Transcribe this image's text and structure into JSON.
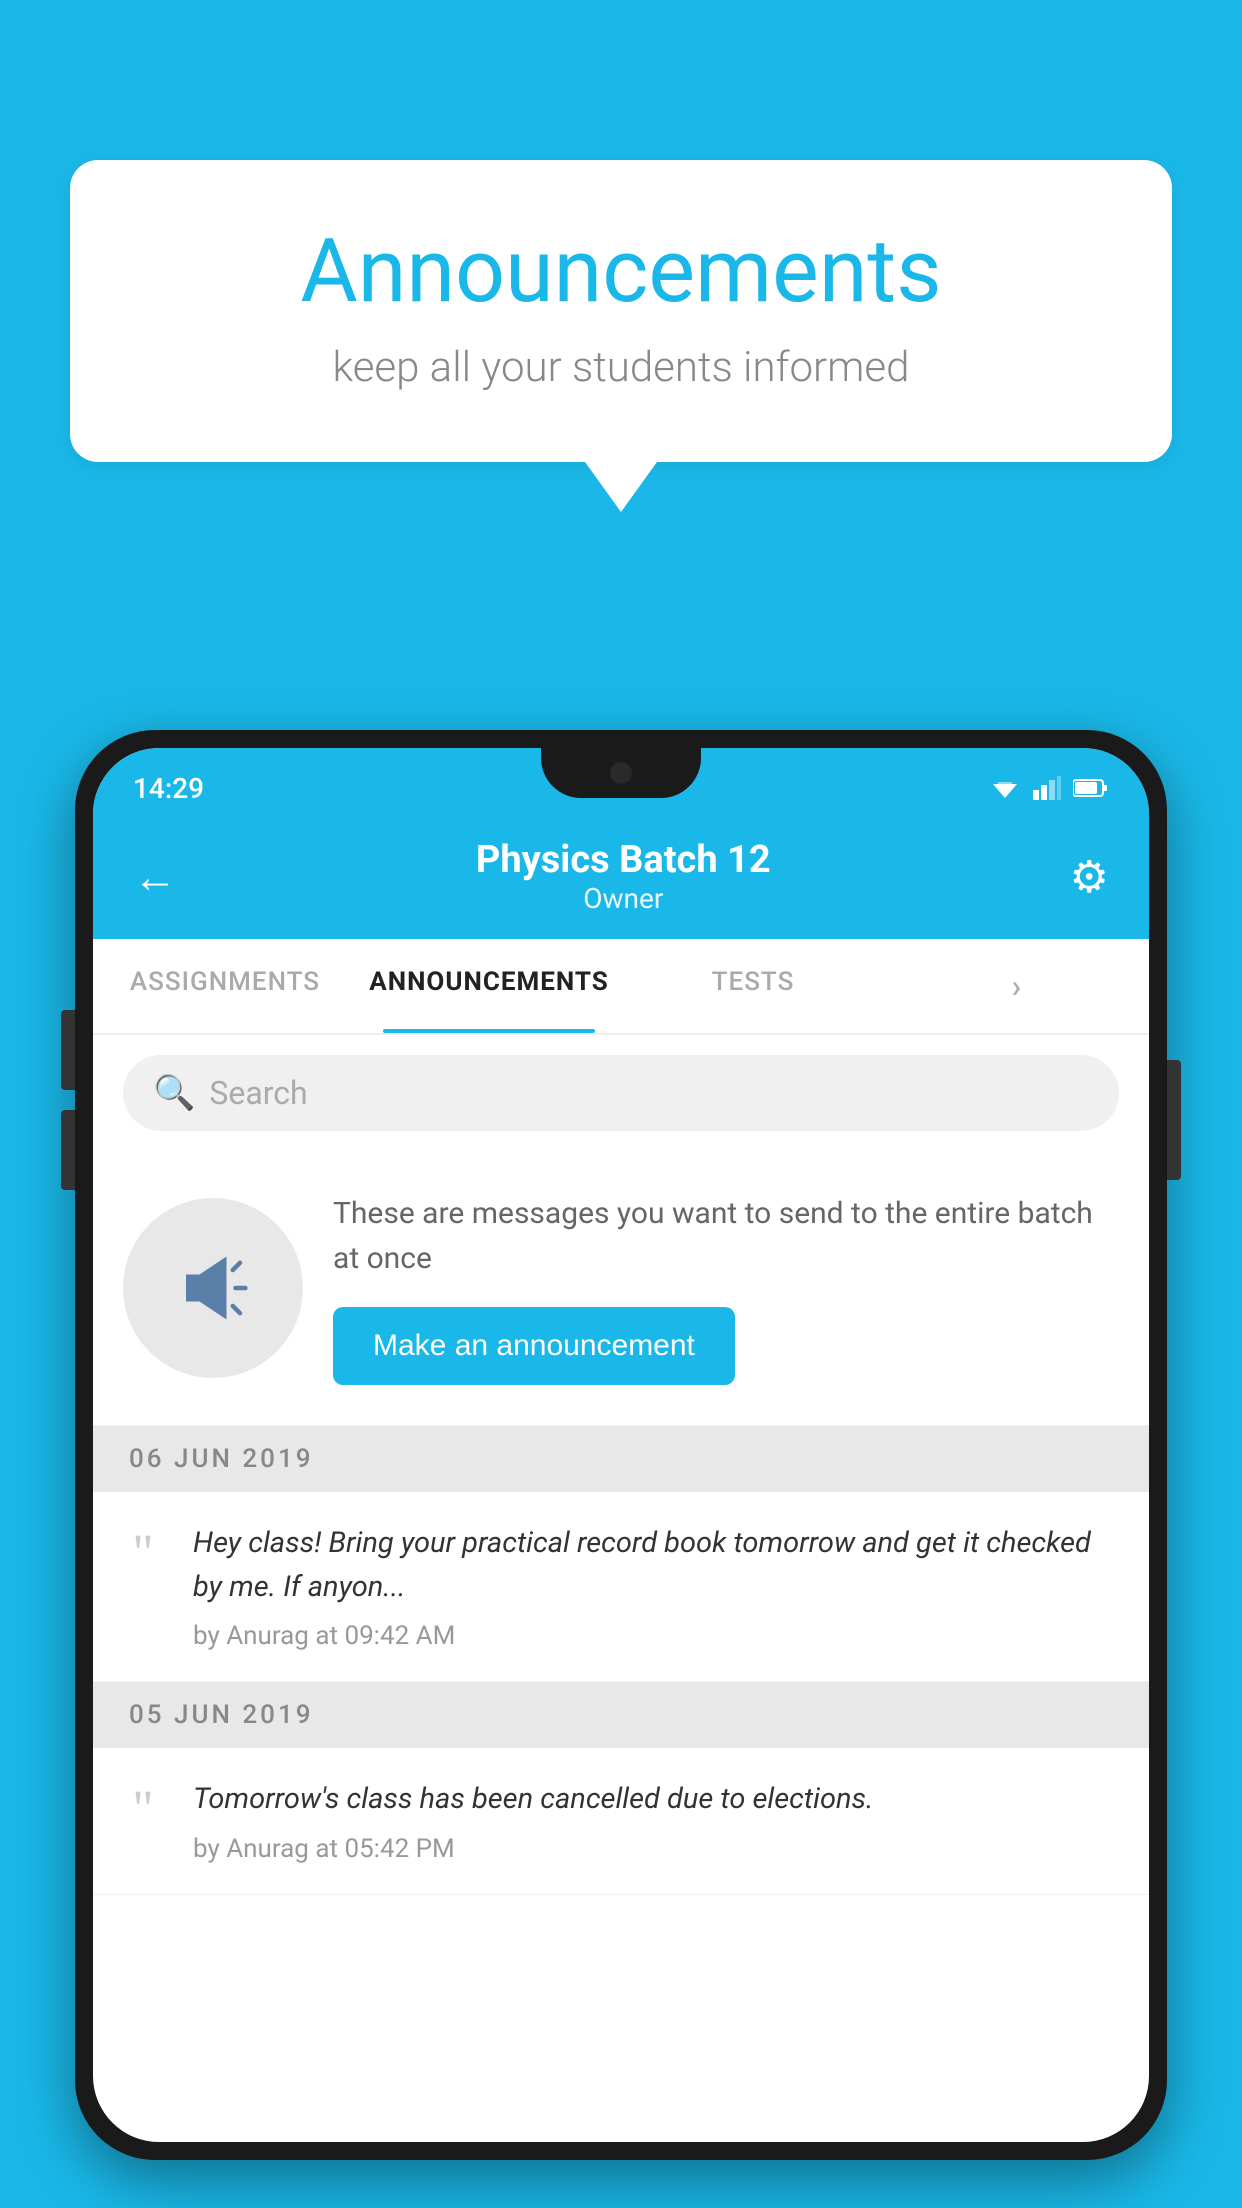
{
  "background": {
    "color": "#1ab8e8"
  },
  "speech_bubble": {
    "title": "Announcements",
    "subtitle": "keep all your students informed"
  },
  "status_bar": {
    "time": "14:29"
  },
  "app_header": {
    "title": "Physics Batch 12",
    "subtitle": "Owner",
    "back_label": "←",
    "gear_label": "⚙"
  },
  "tabs": [
    {
      "label": "ASSIGNMENTS",
      "active": false
    },
    {
      "label": "ANNOUNCEMENTS",
      "active": true
    },
    {
      "label": "TESTS",
      "active": false
    },
    {
      "label": "···",
      "active": false
    }
  ],
  "search": {
    "placeholder": "Search"
  },
  "promo": {
    "description": "These are messages you want to send to the entire batch at once",
    "button_label": "Make an announcement"
  },
  "announcements": [
    {
      "date": "06  JUN  2019",
      "text": "Hey class! Bring your practical record book tomorrow and get it checked by me. If anyon...",
      "meta": "by Anurag at 09:42 AM"
    },
    {
      "date": "05  JUN  2019",
      "text": "Tomorrow's class has been cancelled due to elections.",
      "meta": "by Anurag at 05:42 PM"
    }
  ]
}
